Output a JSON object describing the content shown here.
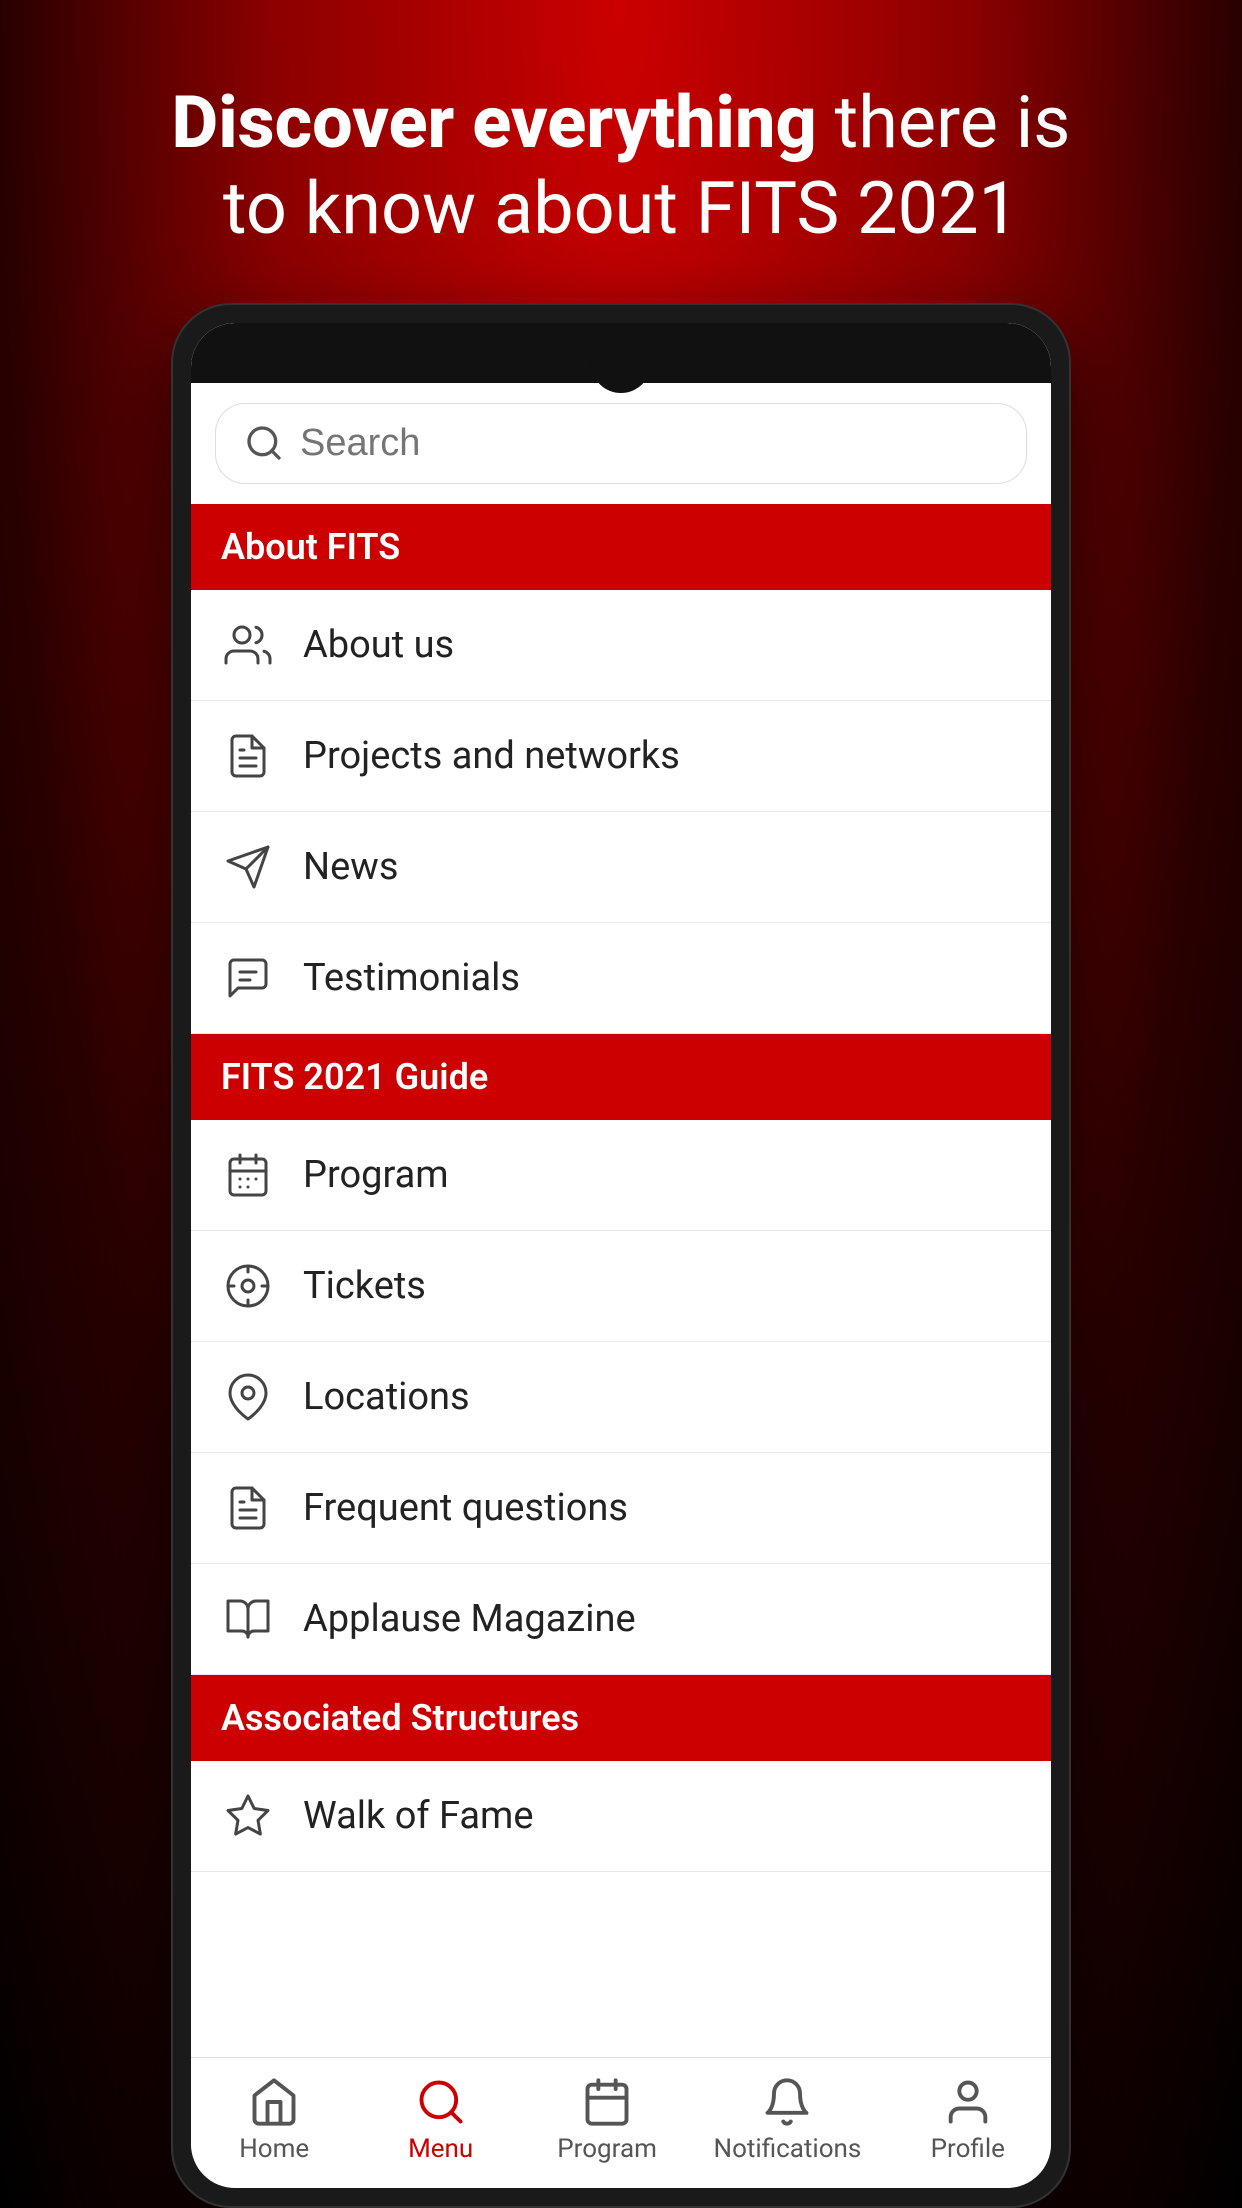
{
  "hero": {
    "line1_bold": "Discover everything",
    "line1_normal": " there is",
    "line2": "to know about FITS 2021"
  },
  "search": {
    "placeholder": "Search"
  },
  "sections": [
    {
      "id": "about-fits",
      "label": "About FITS",
      "items": [
        {
          "id": "about-us",
          "label": "About us",
          "icon": "people-icon"
        },
        {
          "id": "projects-networks",
          "label": "Projects and networks",
          "icon": "projects-icon"
        },
        {
          "id": "news",
          "label": "News",
          "icon": "news-icon"
        },
        {
          "id": "testimonials",
          "label": "Testimonials",
          "icon": "testimonials-icon"
        }
      ]
    },
    {
      "id": "fits-2021-guide",
      "label": "FITS 2021 Guide",
      "items": [
        {
          "id": "program",
          "label": "Program",
          "icon": "calendar-icon"
        },
        {
          "id": "tickets",
          "label": "Tickets",
          "icon": "ticket-icon"
        },
        {
          "id": "locations",
          "label": "Locations",
          "icon": "location-icon"
        },
        {
          "id": "frequent-questions",
          "label": "Frequent questions",
          "icon": "faq-icon"
        },
        {
          "id": "applause-magazine",
          "label": "Applause Magazine",
          "icon": "magazine-icon"
        }
      ]
    },
    {
      "id": "associated-structures",
      "label": "Associated Structures",
      "items": [
        {
          "id": "walk-of-fame",
          "label": "Walk of Fame",
          "icon": "star-icon"
        }
      ]
    }
  ],
  "bottom_nav": [
    {
      "id": "home",
      "label": "Home",
      "icon": "home-icon",
      "active": false
    },
    {
      "id": "menu",
      "label": "Menu",
      "icon": "menu-icon",
      "active": true
    },
    {
      "id": "program-nav",
      "label": "Program",
      "icon": "calendar-nav-icon",
      "active": false
    },
    {
      "id": "notifications",
      "label": "Notifications",
      "icon": "bell-icon",
      "active": false
    },
    {
      "id": "profile",
      "label": "Profile",
      "icon": "profile-icon",
      "active": false
    }
  ]
}
